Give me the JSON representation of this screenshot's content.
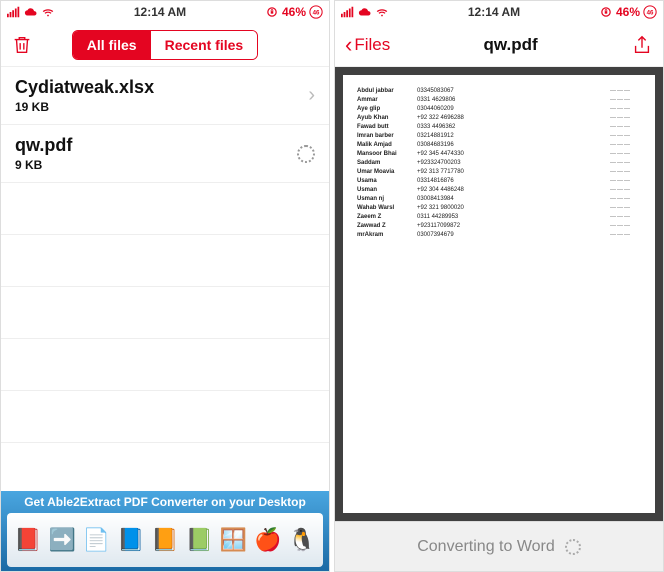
{
  "status": {
    "time": "12:14 AM",
    "battery": "46%"
  },
  "screen_left": {
    "segmented": {
      "all": "All files",
      "recent": "Recent files"
    },
    "files": [
      {
        "name": "Cydiatweak.xlsx",
        "size": "19 KB"
      },
      {
        "name": "qw.pdf",
        "size": "9 KB"
      }
    ],
    "promo_text": "Get Able2Extract PDF Converter on your Desktop"
  },
  "screen_right": {
    "back_label": "Files",
    "title": "qw.pdf",
    "converting_label": "Converting to Word",
    "document_rows": [
      {
        "name": "Abdul jabbar",
        "num": "03345083067"
      },
      {
        "name": "Ammar",
        "num": "0331 4629806"
      },
      {
        "name": "Aye glip",
        "num": "03044060209"
      },
      {
        "name": "Ayub Khan",
        "num": "+92 322 4696288"
      },
      {
        "name": "Fawad butt",
        "num": "0333 4496362"
      },
      {
        "name": "Imran barber",
        "num": "03214881912"
      },
      {
        "name": "Malik Amjad",
        "num": "03084683196"
      },
      {
        "name": "Mansoor Bhai",
        "num": "+92 345 4474330"
      },
      {
        "name": "Saddam",
        "num": "+923324700203"
      },
      {
        "name": "Umar Moavia",
        "num": "+92 313 7717780"
      },
      {
        "name": "Usama",
        "num": "03314816876"
      },
      {
        "name": "Usman",
        "num": "+92 304 4486248"
      },
      {
        "name": "Usman nj",
        "num": "03008413984"
      },
      {
        "name": "Wahab Warsl",
        "num": "+92 321 9800020"
      },
      {
        "name": "Zaeem Z",
        "num": "0311 44289953"
      },
      {
        "name": "Zawwad Z",
        "num": "+923117099872"
      },
      {
        "name": "mrAkram",
        "num": "03007394679"
      }
    ]
  }
}
